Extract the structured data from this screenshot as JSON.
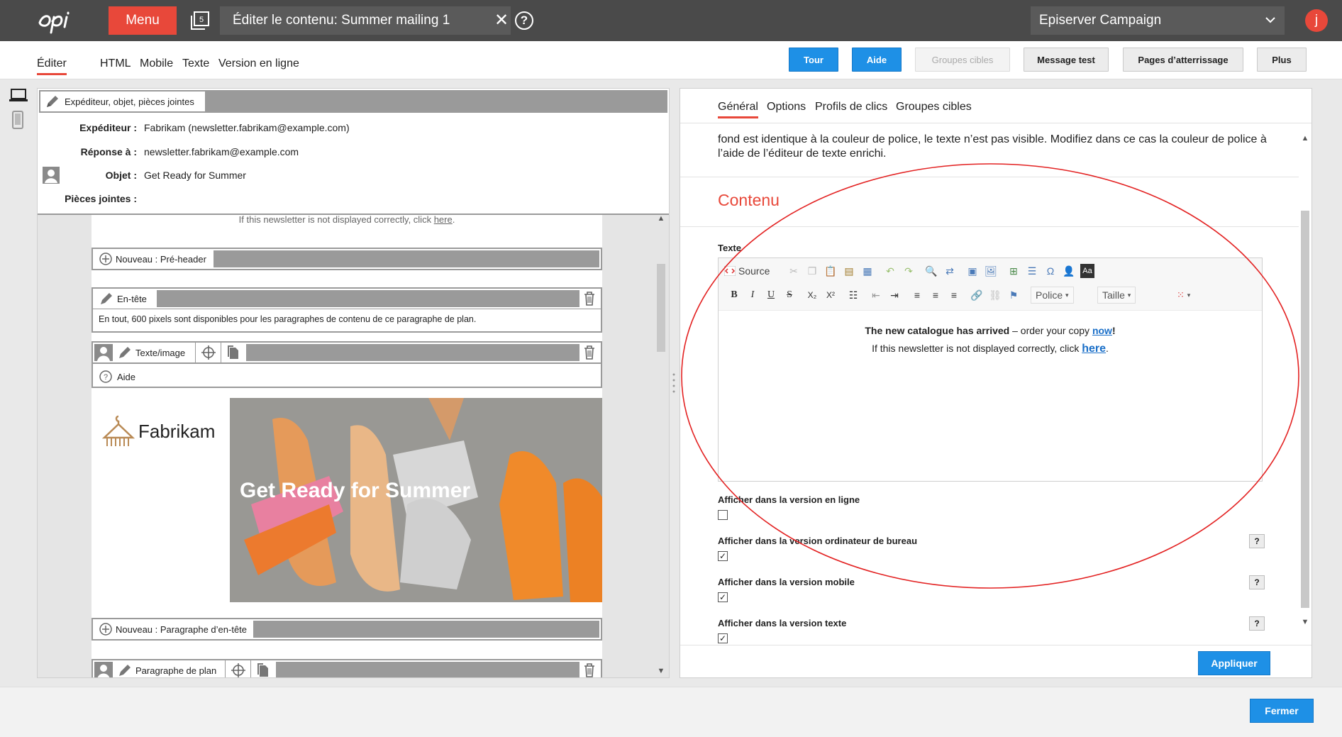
{
  "topbar": {
    "menu_label": "Menu",
    "tabs_count": "5",
    "title": "Éditer le contenu: Summer mailing 1",
    "campaign": "Episerver Campaign",
    "avatar_letter": "j"
  },
  "subnav": {
    "tabs": [
      "Éditer",
      "HTML",
      "Mobile",
      "Texte",
      "Version en ligne"
    ],
    "buttons": {
      "tour": "Tour",
      "aide": "Aide",
      "groupes": "Groupes cibles",
      "message_test": "Message test",
      "pages": "Pages d’atterrissage",
      "plus": "Plus"
    }
  },
  "sender": {
    "bar_label": "Expéditeur, objet, pièces jointes",
    "fields": [
      {
        "label": "Expéditeur :",
        "value": "Fabrikam (newsletter.fabrikam@example.com)"
      },
      {
        "label": "Réponse à :",
        "value": "newsletter.fabrikam@example.com"
      },
      {
        "label": "Objet :",
        "value": "Get Ready for Summer"
      },
      {
        "label": "Pièces jointes :",
        "value": ""
      }
    ]
  },
  "preview": {
    "notice_text": "If this newsletter is not displayed correctly, click ",
    "notice_link": "here",
    "notice_end": ".",
    "blocks": {
      "preheader": "Nouveau : Pré-header",
      "entete": "En-tête",
      "entete_info": "En tout, 600 pixels sont disponibles pour les paragraphes de contenu de ce paragraphe de plan.",
      "texte_image": "Texte/image",
      "aide": "Aide",
      "brand": "Fabrikam",
      "hero_text": "Get Ready for Summer",
      "nouveau_para": "Nouveau : Paragraphe d’en-tête",
      "para_plan": "Paragraphe de plan"
    }
  },
  "right": {
    "tabs": [
      "Général",
      "Options",
      "Profils de clics",
      "Groupes cibles"
    ],
    "description": "fond est identique à la couleur de police, le texte n’est pas visible. Modifiez dans ce cas la couleur de police à l’aide de l’éditeur de texte enrichi.",
    "section_title": "Contenu",
    "texte_label": "Texte",
    "toolbar": {
      "source": "Source",
      "police": "Police",
      "taille": "Taille"
    },
    "editor": {
      "line1_bold": "The new catalogue has arrived",
      "line1_rest": " – order your copy ",
      "line1_link": "now",
      "line1_end": "!",
      "line2_text": "If this newsletter is not displayed correctly, click ",
      "line2_link": "here",
      "line2_end": "."
    },
    "options": [
      {
        "label": "Afficher dans la version en ligne",
        "checked": false
      },
      {
        "label": "Afficher dans la version ordinateur de bureau",
        "checked": true
      },
      {
        "label": "Afficher dans la version mobile",
        "checked": true
      },
      {
        "label": "Afficher dans la version texte",
        "checked": true
      }
    ],
    "help_q": "?",
    "apply": "Appliquer"
  },
  "bottom": {
    "close": "Fermer"
  },
  "colors": {
    "accent": "#e8483a",
    "primary": "#1e90e6",
    "topbar": "#4a4a4a"
  }
}
